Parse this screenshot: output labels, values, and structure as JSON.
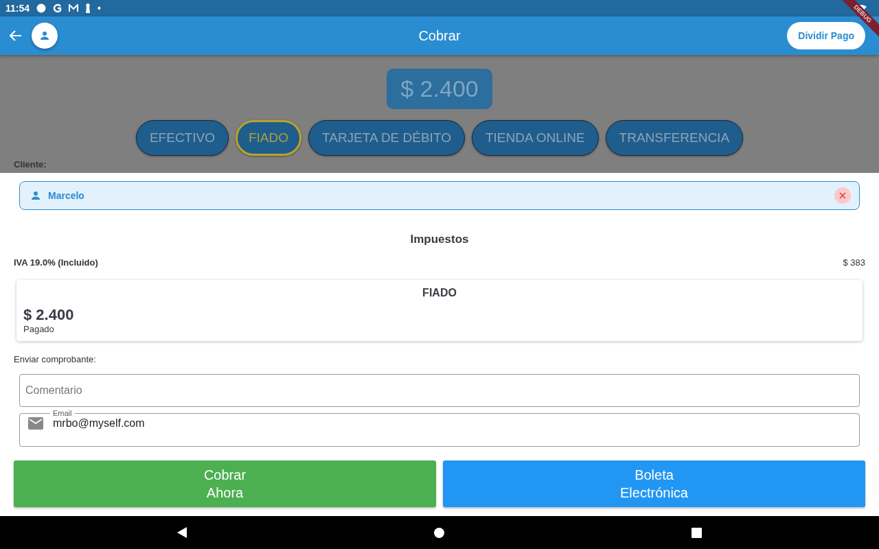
{
  "status_bar": {
    "time": "11:54",
    "dot": "•"
  },
  "debug_banner": "DEBUG",
  "app_bar": {
    "title": "Cobrar",
    "action": "Dividir Pago"
  },
  "amount": "$ 2.400",
  "payment_methods": [
    {
      "label": "EFECTIVO",
      "selected": false
    },
    {
      "label": "FIADO",
      "selected": true
    },
    {
      "label": "TARJETA DE DÉBITO",
      "selected": false
    },
    {
      "label": "TIENDA ONLINE",
      "selected": false
    },
    {
      "label": "TRANSFERENCIA",
      "selected": false
    }
  ],
  "client_label": "Cliente:",
  "client": {
    "name": "Marcelo"
  },
  "taxes": {
    "title": "Impuestos",
    "rows": [
      {
        "label": "IVA 19.0% (Incluido)",
        "value": "$ 383"
      }
    ]
  },
  "payment_card": {
    "method": "FIADO",
    "amount": "$ 2.400",
    "status": "Pagado"
  },
  "receipt": {
    "label": "Enviar comprobante:",
    "comment": {
      "placeholder": "Comentario"
    },
    "email": {
      "label": "Email",
      "value": "mrbo@myself.com"
    }
  },
  "buttons": [
    {
      "kind": "charge",
      "lines": [
        "Cobrar",
        "Ahora"
      ]
    },
    {
      "kind": "invoice",
      "lines": [
        "Boleta",
        "Electrónica"
      ]
    }
  ]
}
